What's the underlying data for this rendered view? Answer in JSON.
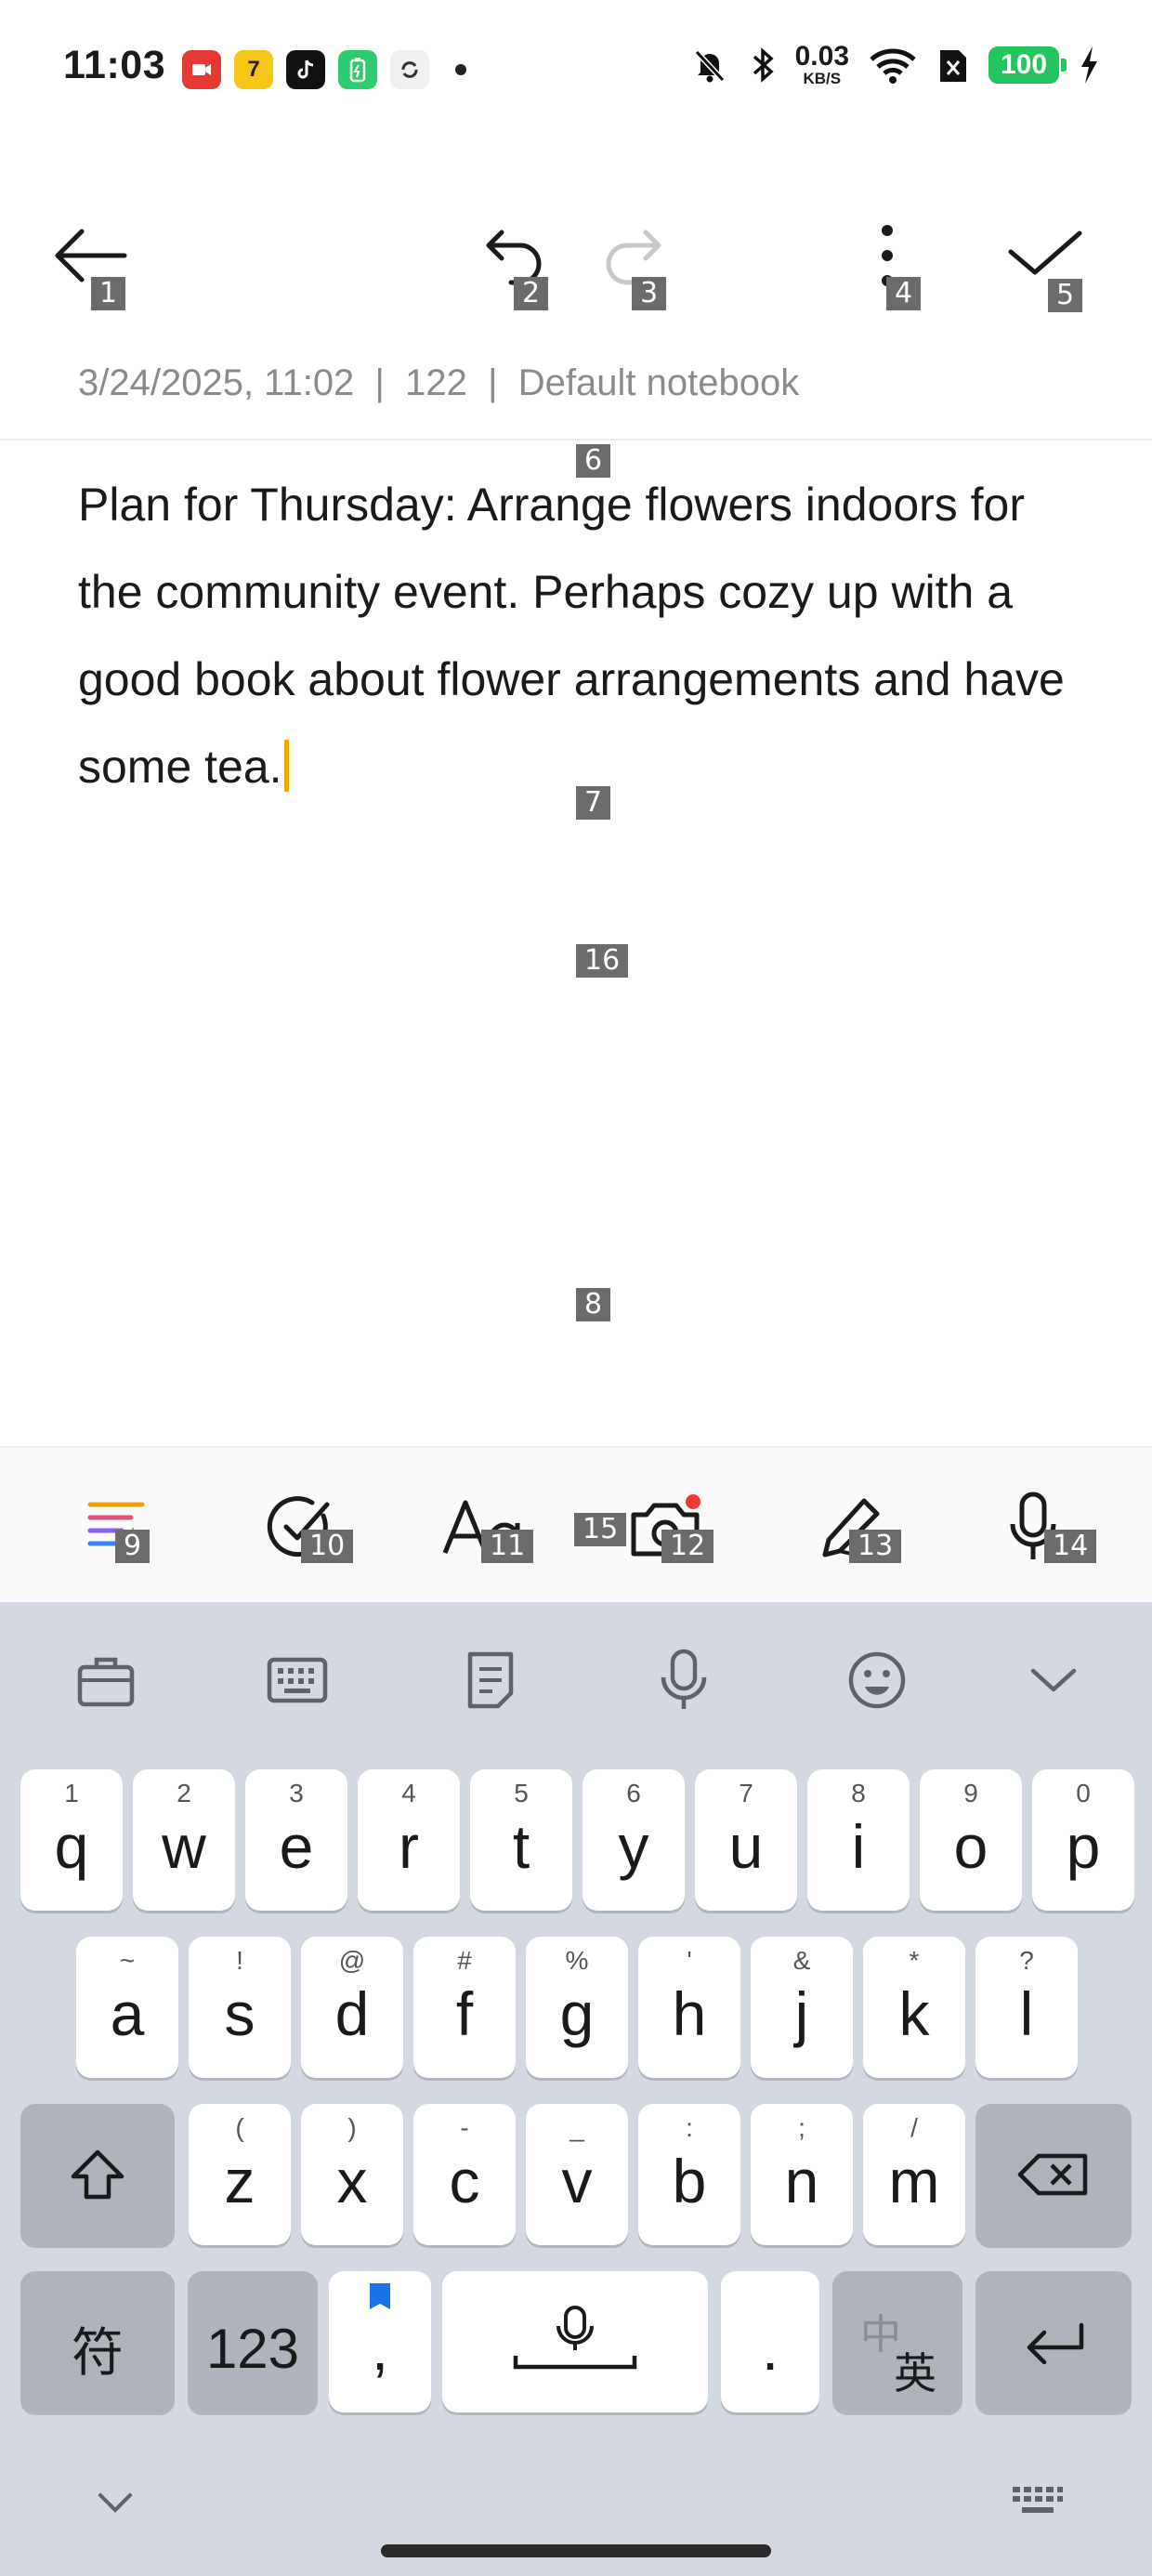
{
  "status_bar": {
    "time": "11:03",
    "net_speed_value": "0.03",
    "net_speed_unit": "KB/S",
    "battery_level": "100",
    "app_icons": [
      "screen-recorder-icon",
      "seven-cats-icon",
      "tiktok-icon",
      "battery-saver-icon",
      "sync-icon"
    ]
  },
  "toolbar": {
    "labels": [
      "1",
      "2",
      "3",
      "4",
      "5"
    ]
  },
  "note": {
    "date": "3/24/2025, 11:02",
    "separator": "|",
    "char_count": "122",
    "notebook": "Default notebook",
    "body": "Plan for Thursday: Arrange flowers indoors for the community event. Perhaps cozy up with a good book about flower arrangements and have some tea."
  },
  "overlay_labels": [
    "6",
    "7",
    "8",
    "9",
    "10",
    "11",
    "12",
    "13",
    "14",
    "15",
    "16"
  ],
  "tools": {
    "icons": [
      "ai-writing-icon",
      "checklist-icon",
      "text-format-icon",
      "camera-icon",
      "pen-icon",
      "microphone-icon"
    ]
  },
  "keyboard": {
    "top_icons": [
      "clipboard-icon",
      "keyboard-layout-icon",
      "notes-icon",
      "voice-input-icon",
      "emoji-icon",
      "collapse-icon"
    ],
    "row1": [
      {
        "k": "q",
        "h": "1"
      },
      {
        "k": "w",
        "h": "2"
      },
      {
        "k": "e",
        "h": "3"
      },
      {
        "k": "r",
        "h": "4"
      },
      {
        "k": "t",
        "h": "5"
      },
      {
        "k": "y",
        "h": "6"
      },
      {
        "k": "u",
        "h": "7"
      },
      {
        "k": "i",
        "h": "8"
      },
      {
        "k": "o",
        "h": "9"
      },
      {
        "k": "p",
        "h": "0"
      }
    ],
    "row2": [
      {
        "k": "a",
        "h": "~"
      },
      {
        "k": "s",
        "h": "!"
      },
      {
        "k": "d",
        "h": "@"
      },
      {
        "k": "f",
        "h": "#"
      },
      {
        "k": "g",
        "h": "%"
      },
      {
        "k": "h",
        "h": "'"
      },
      {
        "k": "j",
        "h": "&"
      },
      {
        "k": "k",
        "h": "*"
      },
      {
        "k": "l",
        "h": "?"
      }
    ],
    "row3": [
      {
        "k": "z",
        "h": "("
      },
      {
        "k": "x",
        "h": ")"
      },
      {
        "k": "c",
        "h": "-"
      },
      {
        "k": "v",
        "h": "_"
      },
      {
        "k": "b",
        "h": ":"
      },
      {
        "k": "n",
        "h": ";"
      },
      {
        "k": "m",
        "h": "/"
      }
    ],
    "symbols_key": "符",
    "numbers_key": "123",
    "comma_key": ",",
    "period_key": ".",
    "lang_key_top": "中",
    "lang_key_bottom": "英"
  }
}
